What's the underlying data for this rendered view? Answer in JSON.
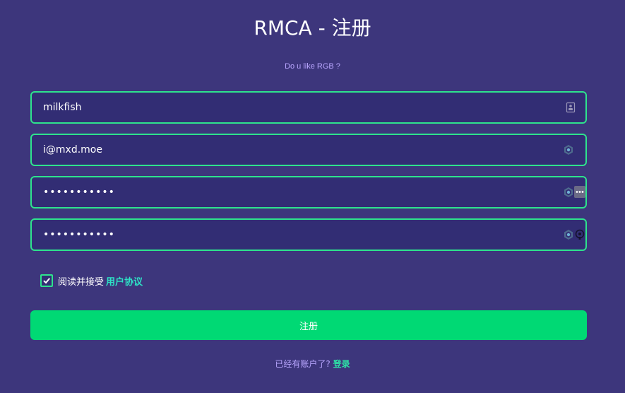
{
  "header": {
    "title": "RMCA - 注册",
    "subtitle": "Do u like RGB ?"
  },
  "form": {
    "username": {
      "value": "milkfish",
      "icon": "contact-card-icon"
    },
    "email": {
      "value": "i@mxd.moe",
      "icon": "password-manager-icon"
    },
    "password": {
      "value": "12345678901",
      "icons": [
        "password-manager-icon",
        "more-dots-icon"
      ]
    },
    "confirm_password": {
      "value": "12345678901",
      "icons": [
        "password-manager-icon",
        "key-icon"
      ]
    }
  },
  "agreement": {
    "checked": true,
    "text": "阅读并接受",
    "link": "用户协议"
  },
  "submit_label": "注册",
  "footer": {
    "prompt": "已经有账户了?",
    "login_link": "登录"
  },
  "colors": {
    "background": "#3d367c",
    "field_bg": "#322d74",
    "accent_border": "#2ee38d",
    "button": "#00d974",
    "subtitle": "#b9a6ff",
    "link": "#2ee3c6"
  }
}
